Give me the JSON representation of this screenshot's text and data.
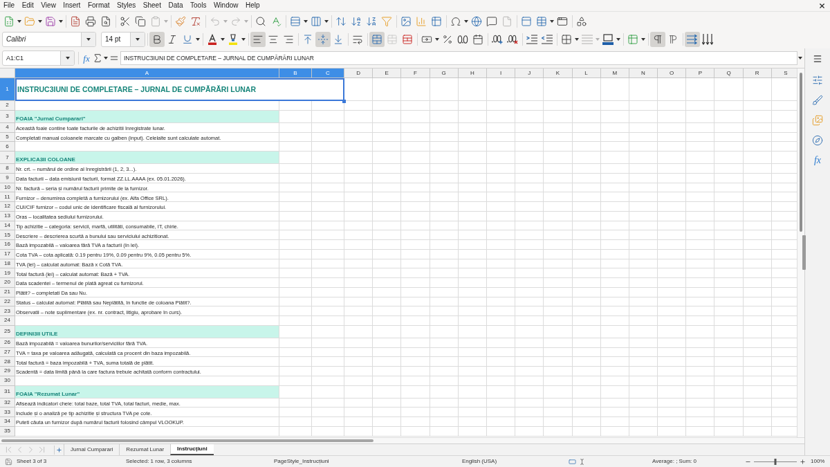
{
  "menu": [
    "File",
    "Edit",
    "View",
    "Insert",
    "Format",
    "Styles",
    "Sheet",
    "Data",
    "Tools",
    "Window",
    "Help"
  ],
  "standard_toolbar": {
    "paste": {
      "disabled": true
    },
    "undo": {
      "disabled": true
    },
    "redo": {
      "disabled": true
    },
    "page_button": {
      "disabled": true
    }
  },
  "formatting_toolbar": {
    "font_name": "Calibri",
    "font_size": "14 pt",
    "bold": {
      "on": true
    },
    "italic": {
      "on": false
    },
    "underline": {
      "on": false
    },
    "align_left": {
      "on": true
    },
    "align_center": {
      "on": false
    },
    "align_right": {
      "on": false
    },
    "align_top": {
      "on": false
    },
    "align_middle": {
      "on": true
    },
    "align_bottom": {
      "on": false
    },
    "wrap_text": {
      "on": false
    },
    "merge_and_center": {
      "on": true
    },
    "merge_cells": {
      "on": false,
      "disabled": true
    },
    "unmerge_cells": {
      "on": false
    },
    "border_style": {
      "disabled": true
    },
    "left_to_right": {
      "on": true
    },
    "right_to_left": {
      "on": false
    },
    "horizontal_text": {
      "on": true
    },
    "vertical_text": {
      "on": false
    }
  },
  "formula_bar": {
    "name_box": "A1:C1",
    "function_wizard": "fx",
    "content": "INSTRUC3IUNI DE COMPLETARE – JURNAL DE CUMPĂRĂRI LUNAR"
  },
  "sheet": {
    "columns": [
      {
        "label": "A",
        "selected": true
      },
      {
        "label": "B",
        "selected": true
      },
      {
        "label": "C",
        "selected": true
      },
      {
        "label": "D",
        "selected": false
      },
      {
        "label": "E",
        "selected": false
      },
      {
        "label": "F",
        "selected": false
      },
      {
        "label": "G",
        "selected": false
      },
      {
        "label": "H",
        "selected": false
      },
      {
        "label": "I",
        "selected": false
      },
      {
        "label": "J",
        "selected": false
      },
      {
        "label": "K",
        "selected": false
      },
      {
        "label": "L",
        "selected": false
      },
      {
        "label": "M",
        "selected": false
      },
      {
        "label": "N",
        "selected": false
      },
      {
        "label": "O",
        "selected": false
      },
      {
        "label": "P",
        "selected": false
      },
      {
        "label": "Q",
        "selected": false
      },
      {
        "label": "R",
        "selected": false
      },
      {
        "label": "S",
        "selected": false
      }
    ],
    "rows": [
      {
        "number": "1",
        "selected": true,
        "kind": "title",
        "text": "INSTRUC3IUNI DE COMPLETARE – JURNAL DE CUMPĂRĂRI LUNAR"
      },
      {
        "number": "2",
        "selected": false,
        "kind": "blank"
      },
      {
        "number": "3",
        "selected": false,
        "kind": "section",
        "text": "FOAIA \"Jurnal Cumparari\""
      },
      {
        "number": "4",
        "selected": false,
        "kind": "text",
        "text": "Această foaie contine toate facturile de achizitii înregistrate lunar."
      },
      {
        "number": "5",
        "selected": false,
        "kind": "text",
        "text": "Completati manual coloanele marcate cu galben (input). Celelalte sunt calculate automat."
      },
      {
        "number": "6",
        "selected": false,
        "kind": "blank"
      },
      {
        "number": "7",
        "selected": false,
        "kind": "section",
        "text": "EXPLICA3II COLOANE"
      },
      {
        "number": "8",
        "selected": false,
        "kind": "text",
        "text": "Nr. crt. – numărul de ordine al înregistrării (1, 2, 3...)."
      },
      {
        "number": "9",
        "selected": false,
        "kind": "text",
        "text": "Data facturii – data emisiunii facturii, format ZZ.LL.AAAA (ex. 05.01.2026)."
      },
      {
        "number": "10",
        "selected": false,
        "kind": "text",
        "text": "Nr. factură – seria și numărul facturii primite de la furnizor."
      },
      {
        "number": "11",
        "selected": false,
        "kind": "text",
        "text": "Furnizor – denumirea completă a furnizorului (ex. Alfa Office SRL)."
      },
      {
        "number": "12",
        "selected": false,
        "kind": "text",
        "text": "CUI/CIF furnizor – codul unic de identificare fiscală al furnizorului."
      },
      {
        "number": "13",
        "selected": false,
        "kind": "text",
        "text": "Oras – localitatea sediului furnizorului."
      },
      {
        "number": "14",
        "selected": false,
        "kind": "text",
        "text": "Tip achizitie – categoria: servicii, marfă, utilităti, consumabile, IT, chirie."
      },
      {
        "number": "15",
        "selected": false,
        "kind": "text",
        "text": "Descriere – descrierea scurtă a bunului sau serviciului achizitionat."
      },
      {
        "number": "16",
        "selected": false,
        "kind": "text",
        "text": "Bază impozabilă – valoarea fără TVA a facturii (în lei)."
      },
      {
        "number": "17",
        "selected": false,
        "kind": "text",
        "text": "Cota TVA – cota aplicată: 0.19 pentru 19%, 0.09 pentru 9%, 0.05 pentru 5%."
      },
      {
        "number": "18",
        "selected": false,
        "kind": "text",
        "text": "TVA (lei) – calculat automat: Bază x Cotă TVA."
      },
      {
        "number": "19",
        "selected": false,
        "kind": "text",
        "text": "Total factură (lei) – calculat automat: Bază + TVA."
      },
      {
        "number": "20",
        "selected": false,
        "kind": "text",
        "text": "Data scadentei – termenul de plată agreat cu furnizorul."
      },
      {
        "number": "21",
        "selected": false,
        "kind": "text",
        "text": "Plătit? – completati Da sau Nu."
      },
      {
        "number": "22",
        "selected": false,
        "kind": "text",
        "text": "Status – calculat automat: Plătită sau Neplătită, în functie de coloana Plătit?."
      },
      {
        "number": "23",
        "selected": false,
        "kind": "text",
        "text": "Observatii – note suplimentare (ex. nr. contract, litigiu, aprobare în curs)."
      },
      {
        "number": "24",
        "selected": false,
        "kind": "blank"
      },
      {
        "number": "25",
        "selected": false,
        "kind": "section",
        "text": "DEFINI3II UTILE"
      },
      {
        "number": "26",
        "selected": false,
        "kind": "text",
        "text": "Bază impozabilă = valoarea bunurilor/serviciilor fără TVA."
      },
      {
        "number": "27",
        "selected": false,
        "kind": "text",
        "text": "TVA = taxa pe valoarea adăugată, calculată ca procent din baza impozabilă."
      },
      {
        "number": "28",
        "selected": false,
        "kind": "text",
        "text": "Total factură = baza impozabilă + TVA, suma totală de plătit."
      },
      {
        "number": "29",
        "selected": false,
        "kind": "text",
        "text": "Scadentă = data limită până la care factura trebuie achitată conform contractului."
      },
      {
        "number": "30",
        "selected": false,
        "kind": "blank"
      },
      {
        "number": "31",
        "selected": false,
        "kind": "section",
        "text": "FOAIA \"Rezumat Lunar\""
      },
      {
        "number": "32",
        "selected": false,
        "kind": "text",
        "text": "Afisează indicatori cheie: total baze, total TVA, total facturi, medie, max."
      },
      {
        "number": "33",
        "selected": false,
        "kind": "text",
        "text": "Include și o analiză pe tip achizitie și structura TVA pe cote."
      },
      {
        "number": "34",
        "selected": false,
        "kind": "text",
        "text": "Puteti căuta un furnizor după numărul facturii folosind câmpul VLOOKUP."
      },
      {
        "number": "35",
        "selected": false,
        "kind": "blank"
      }
    ]
  },
  "sheet_tab_navigation": {
    "disabled": true
  },
  "sheet_tabs": [
    {
      "label": "Jurnal Cumparari",
      "selected": false
    },
    {
      "label": "Rezumat Lunar",
      "selected": false
    },
    {
      "label": "Instrucțiuni",
      "selected": true
    }
  ],
  "sidebar": {
    "functions": "fx"
  },
  "status_bar": {
    "sheet": "Sheet 3 of 3",
    "selection": "Selected: 1 row, 3 columns",
    "page_style": "PageStyle_Instrucțiuni",
    "language": "English (USA)",
    "summary": "Average: ; Sum: 0",
    "zoom": {
      "level": 0.5,
      "reading": "100%"
    }
  }
}
